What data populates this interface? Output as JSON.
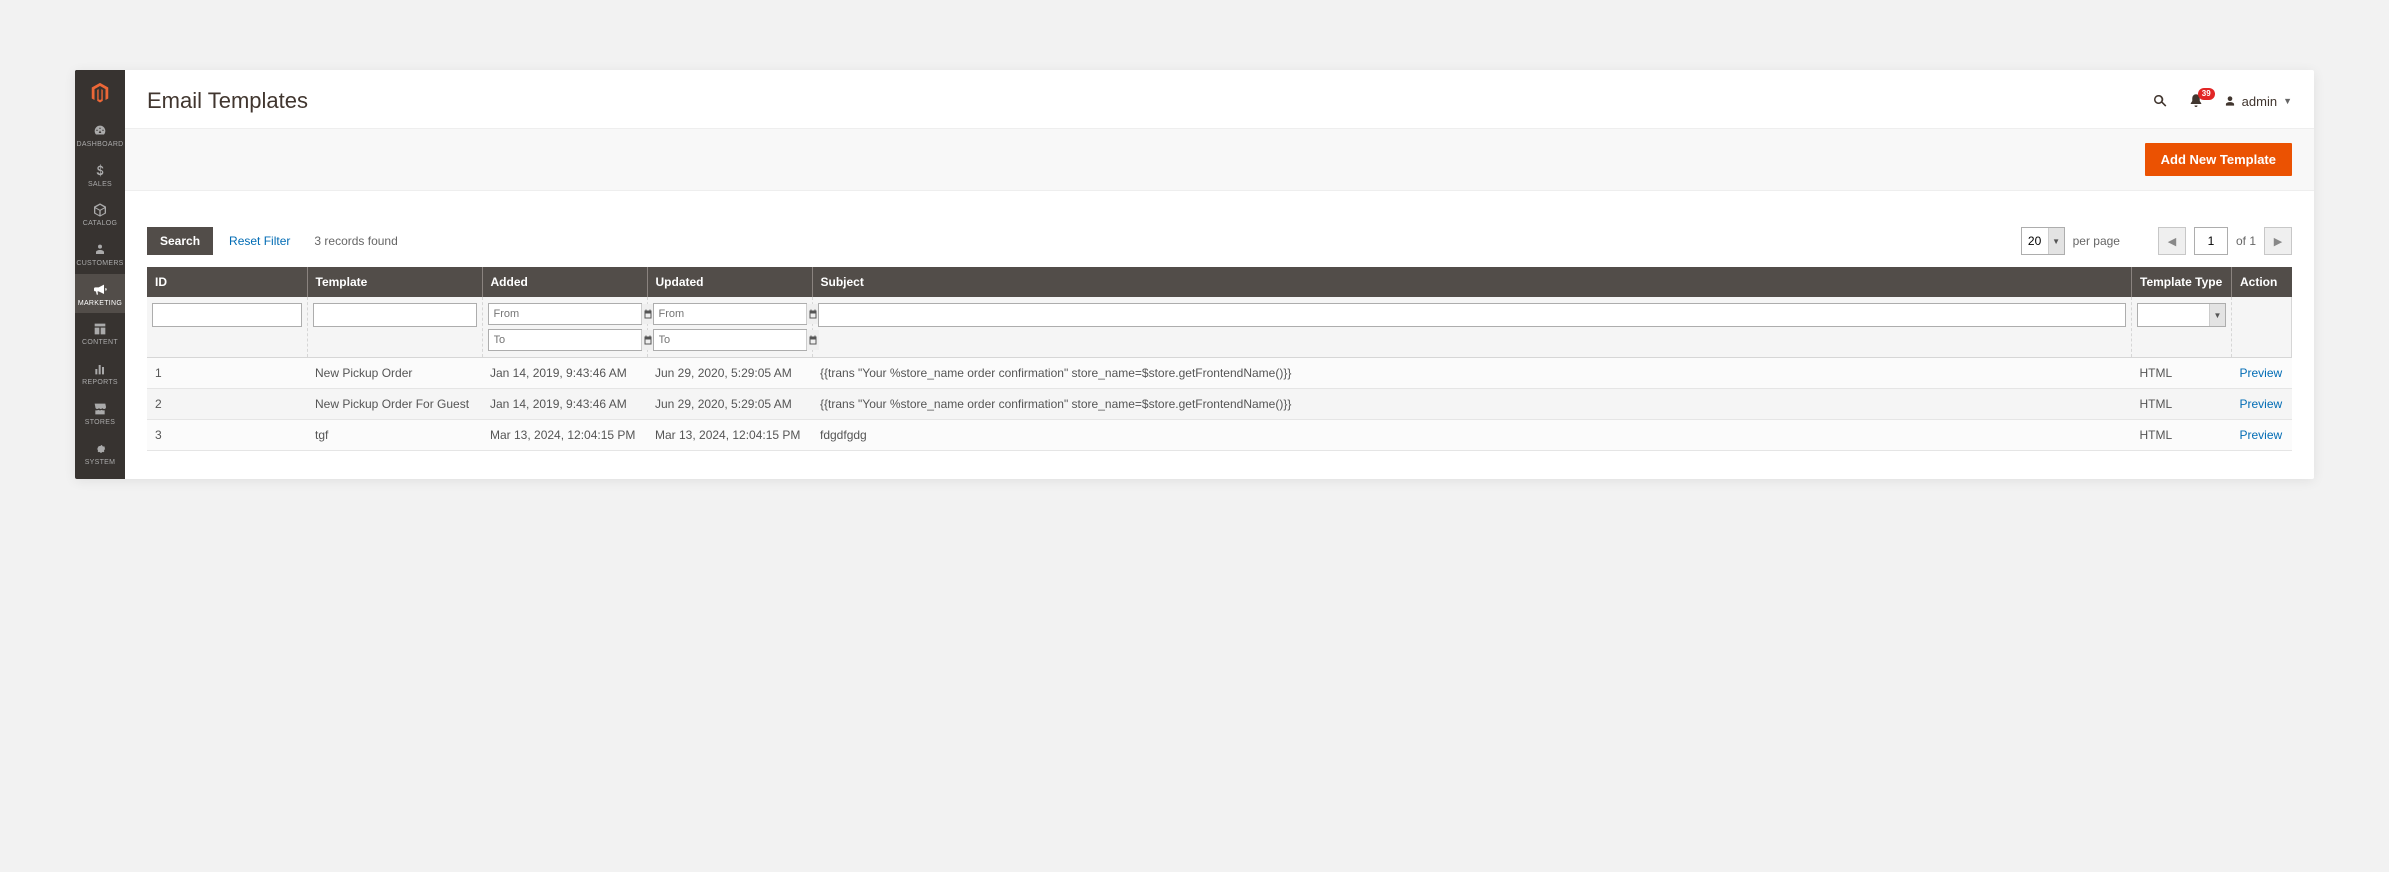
{
  "page": {
    "title": "Email Templates"
  },
  "topbar": {
    "notification_count": "39",
    "user_name": "admin"
  },
  "sidebar": {
    "items": [
      {
        "label": "DASHBOARD"
      },
      {
        "label": "SALES"
      },
      {
        "label": "CATALOG"
      },
      {
        "label": "CUSTOMERS"
      },
      {
        "label": "MARKETING"
      },
      {
        "label": "CONTENT"
      },
      {
        "label": "REPORTS"
      },
      {
        "label": "STORES"
      },
      {
        "label": "SYSTEM"
      }
    ]
  },
  "actions": {
    "add_label": "Add New Template"
  },
  "toolbar": {
    "search_label": "Search",
    "reset_label": "Reset Filter",
    "records_found": "3 records found",
    "page_size": "20",
    "per_page_label": "per page",
    "page_current": "1",
    "page_of_label": "of 1"
  },
  "grid": {
    "headers": {
      "id": "ID",
      "template": "Template",
      "added": "Added",
      "updated": "Updated",
      "subject": "Subject",
      "type": "Template Type",
      "action": "Action"
    },
    "filters": {
      "from_placeholder": "From",
      "to_placeholder": "To"
    },
    "rows": [
      {
        "id": "1",
        "template": "New Pickup Order",
        "added": "Jan 14, 2019, 9:43:46 AM",
        "updated": "Jun 29, 2020, 5:29:05 AM",
        "subject": "{{trans \"Your %store_name order confirmation\" store_name=$store.getFrontendName()}}",
        "type": "HTML",
        "action": "Preview"
      },
      {
        "id": "2",
        "template": "New Pickup Order For Guest",
        "added": "Jan 14, 2019, 9:43:46 AM",
        "updated": "Jun 29, 2020, 5:29:05 AM",
        "subject": "{{trans \"Your %store_name order confirmation\" store_name=$store.getFrontendName()}}",
        "type": "HTML",
        "action": "Preview"
      },
      {
        "id": "3",
        "template": "tgf",
        "added": "Mar 13, 2024, 12:04:15 PM",
        "updated": "Mar 13, 2024, 12:04:15 PM",
        "subject": "fdgdfgdg",
        "type": "HTML",
        "action": "Preview"
      }
    ]
  }
}
